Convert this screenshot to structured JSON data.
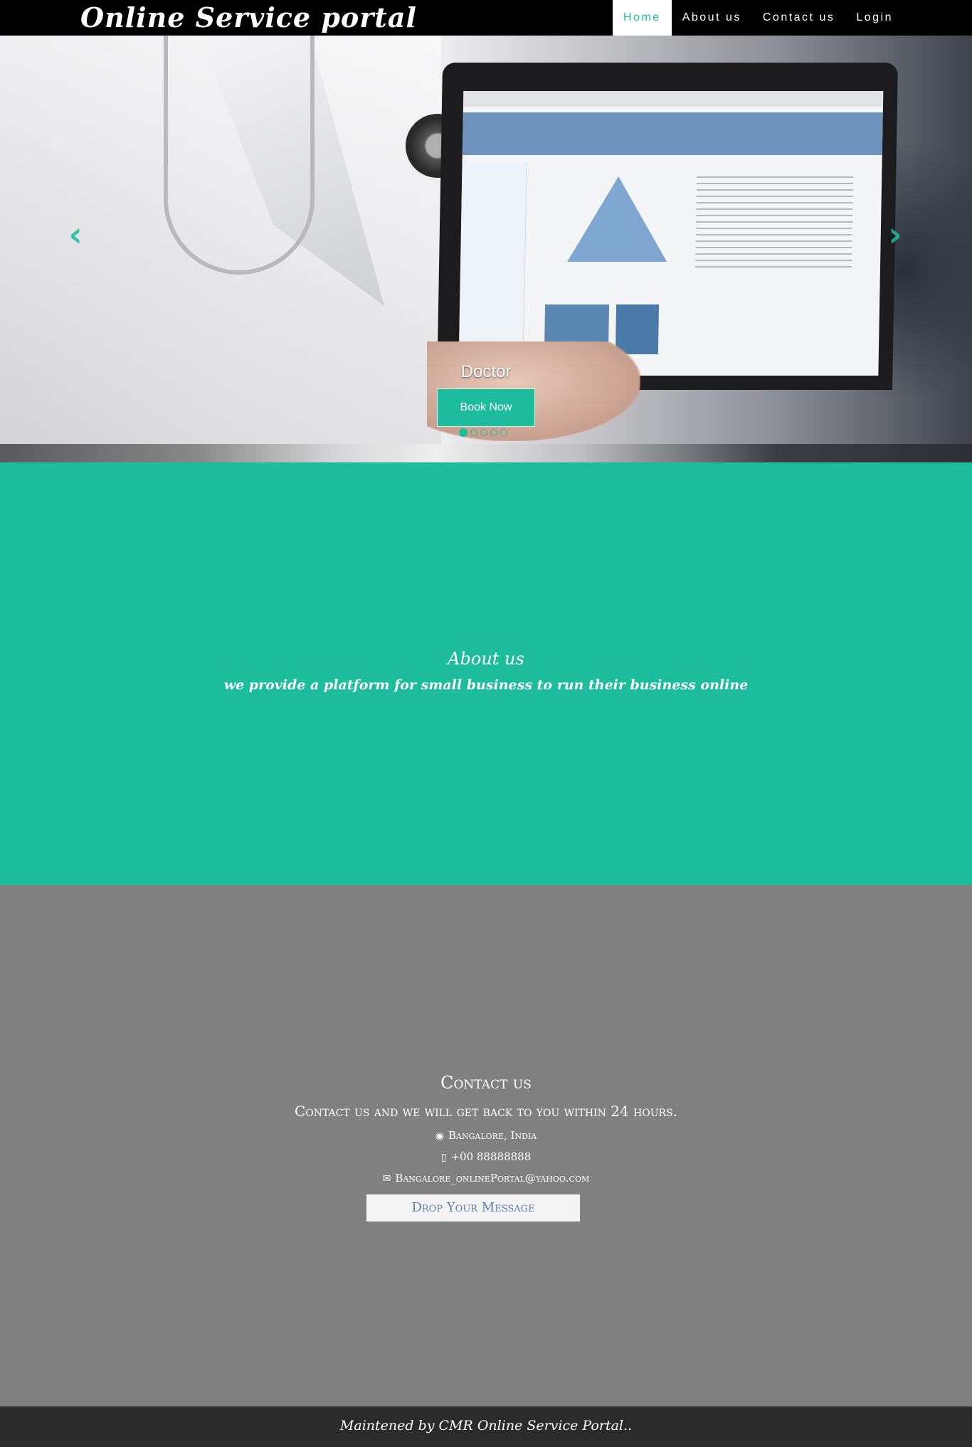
{
  "header": {
    "brand": "Online Service portal",
    "nav": [
      {
        "label": "Home",
        "active": true
      },
      {
        "label": "About us",
        "active": false
      },
      {
        "label": "Contact us",
        "active": false
      },
      {
        "label": "Login",
        "active": false
      }
    ]
  },
  "hero": {
    "caption": "Doctor",
    "button_label": "Book Now",
    "prev_icon": "chevron-left-icon",
    "next_icon": "chevron-right-icon",
    "slide_count": 5,
    "active_slide": 1,
    "accent_color": "#1cbc9c"
  },
  "about": {
    "title": "About us",
    "text": "we provide a platform for small business to run their business online",
    "background": "#1cbc9c"
  },
  "contact": {
    "title": "Contact us",
    "subtitle": "Contact us and we will get back to you within 24 hours.",
    "location": "Bangalore, India",
    "phone": "+00 88888888",
    "email": "Bangalore_onlinePortal@yahoo.com",
    "button_label": "Drop Your Message",
    "background": "#808080"
  },
  "footer": {
    "text": "Maintened by CMR Online Service Portal.."
  }
}
